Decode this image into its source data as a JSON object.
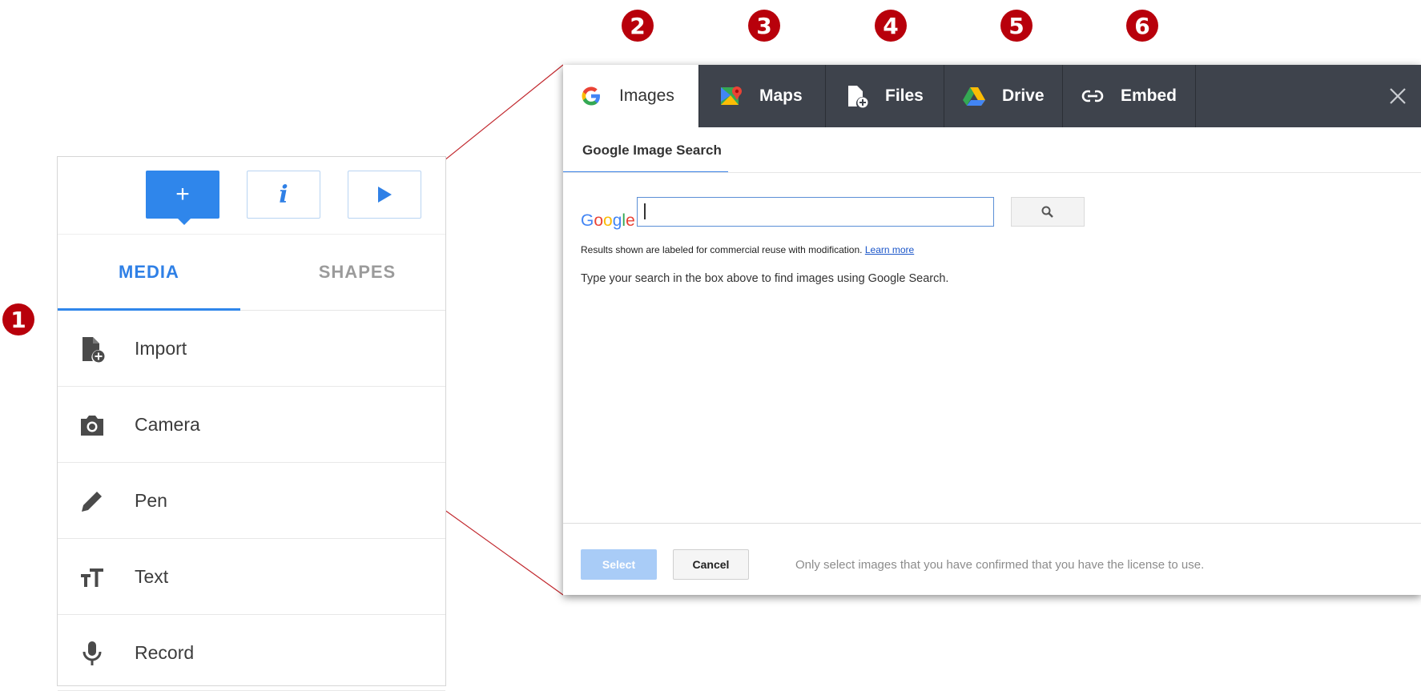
{
  "markers": [
    "1",
    "2",
    "3",
    "4",
    "5",
    "6"
  ],
  "sidebar": {
    "toolbar": {
      "add_symbol": "+",
      "info_symbol": "i"
    },
    "tabs": [
      {
        "label": "MEDIA",
        "active": true
      },
      {
        "label": "SHAPES",
        "active": false
      }
    ],
    "items": [
      {
        "label": "Import",
        "icon": "import-file-icon"
      },
      {
        "label": "Camera",
        "icon": "camera-icon"
      },
      {
        "label": "Pen",
        "icon": "pen-icon"
      },
      {
        "label": "Text",
        "icon": "text-size-icon"
      },
      {
        "label": "Record",
        "icon": "microphone-icon"
      }
    ]
  },
  "dialog": {
    "tabs": [
      {
        "label": "Images",
        "icon": "google-icon",
        "active": true
      },
      {
        "label": "Maps",
        "icon": "maps-icon",
        "active": false
      },
      {
        "label": "Files",
        "icon": "file-add-icon",
        "active": false
      },
      {
        "label": "Drive",
        "icon": "drive-icon",
        "active": false
      },
      {
        "label": "Embed",
        "icon": "link-icon",
        "active": false
      }
    ],
    "subtab": "Google Image Search",
    "search": {
      "logo": "Google",
      "value": ""
    },
    "license_note": "Results shown are labeled for commercial reuse with modification.",
    "learn_more": "Learn more",
    "instructions": "Type your search in the box above to find images using Google Search.",
    "select_label": "Select",
    "cancel_label": "Cancel",
    "footer_note": "Only select images that you have confirmed that you have the license to use."
  },
  "colors": {
    "accent": "#2f86eb",
    "marker": "#b8000b",
    "tabbar": "#3e434c",
    "select_disabled": "#a9ccf7"
  }
}
